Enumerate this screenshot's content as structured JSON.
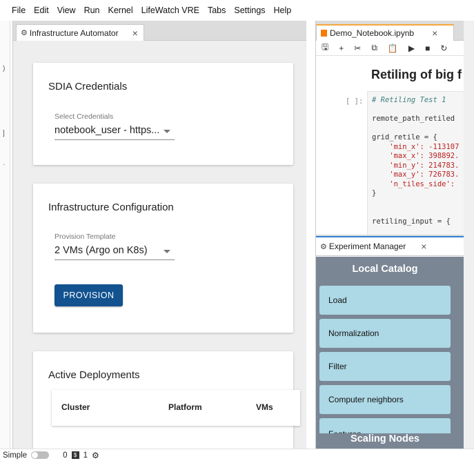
{
  "menu": [
    "File",
    "Edit",
    "View",
    "Run",
    "Kernel",
    "LifeWatch VRE",
    "Tabs",
    "Settings",
    "Help"
  ],
  "left_tab": {
    "icon": "gears-icon",
    "label": "Infrastructure Automator",
    "close": "×"
  },
  "credentials": {
    "title": "SDIA Credentials",
    "select_label": "Select Credentials",
    "select_value": "notebook_user - https..."
  },
  "infra": {
    "title": "Infrastructure Configuration",
    "select_label": "Provision Template",
    "select_value": "2 VMs (Argo on K8s)",
    "button": "PROVISION"
  },
  "deployments": {
    "title": "Active Deployments",
    "columns": [
      "Cluster",
      "Platform",
      "VMs"
    ]
  },
  "notebook": {
    "tab_label": "Demo_Notebook.ipynb",
    "close": "×",
    "toolbar": [
      "save-icon",
      "add-icon",
      "cut-icon",
      "copy-icon",
      "paste-icon",
      "run-icon",
      "stop-icon",
      "restart-icon"
    ],
    "toolbar_glyphs": [
      "🖫",
      "+",
      "✂",
      "⧉",
      "📋",
      "▶",
      "■",
      "↻"
    ],
    "heading": "Retiling of big f",
    "prompt": "[ ]:",
    "code_lines": [
      "# Retiling Test 1",
      "",
      "remote_path_retiled",
      "",
      "grid_retile = {",
      "    'min_x': -113107",
      "    'max_x': 398892.",
      "    'min_y': 214783.",
      "    'max_y': 726783.",
      "    'n_tiles_side':",
      "}",
      "",
      "",
      "retiling_input = {"
    ]
  },
  "experiment": {
    "tab_label": "Experiment Manager",
    "close": "×",
    "catalog_title": "Local Catalog",
    "items": [
      "Load",
      "Normalization",
      "Filter",
      "Computer neighbors",
      "Features"
    ],
    "footer_title": "Scaling Nodes"
  },
  "statusbar": {
    "mode": "Simple",
    "terminals": "0",
    "kernels": "1"
  }
}
